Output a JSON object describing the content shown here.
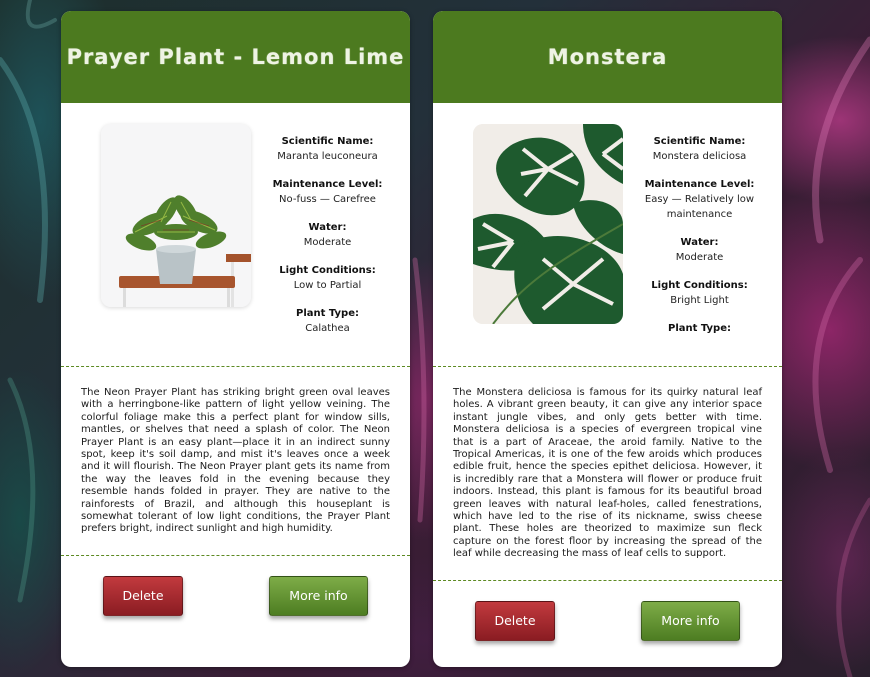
{
  "colors": {
    "header_green": "#4c7a1f",
    "delete_red": "#a82b30",
    "more_info_green": "#6a9a35",
    "divider_green": "#5c8a22"
  },
  "cards": [
    {
      "title": "Prayer Plant - Lemon Lime",
      "image_icon": "potted-prayer-plant-photo",
      "specs": [
        {
          "label": "Scientific Name:",
          "value": "Maranta leuconeura"
        },
        {
          "label": "Maintenance Level:",
          "value": "No-fuss — Carefree"
        },
        {
          "label": "Water:",
          "value": "Moderate"
        },
        {
          "label": "Light Conditions:",
          "value": "Low to Partial"
        },
        {
          "label": "Plant Type:",
          "value": "Calathea"
        }
      ],
      "description": "The Neon Prayer Plant has striking bright green oval leaves with a herringbone-like pattern of light yellow veining. The colorful foliage make this a perfect plant for window sills, mantles, or shelves that need a splash of color. The Neon Prayer Plant is an easy plant—place it in an indirect sunny spot, keep it's soil damp, and mist it's leaves once a week and it will flourish. The Neon Prayer plant gets its name from the way the leaves fold in the evening because they resemble hands folded in prayer. They are native to the rainforests of Brazil, and although this houseplant is somewhat tolerant of low light conditions, the Prayer Plant prefers bright, indirect sunlight and high humidity.",
      "delete_label": "Delete",
      "more_label": "More info"
    },
    {
      "title": "Monstera",
      "image_icon": "monstera-leaves-photo",
      "specs": [
        {
          "label": "Scientific Name:",
          "value": "Monstera deliciosa"
        },
        {
          "label": "Maintenance Level:",
          "value": "Easy — Relatively low maintenance"
        },
        {
          "label": "Water:",
          "value": "Moderate"
        },
        {
          "label": "Light Conditions:",
          "value": "Bright Light"
        },
        {
          "label": "Plant Type:",
          "value": ""
        }
      ],
      "description": "The Monstera deliciosa is famous for its quirky natural leaf holes. A vibrant green beauty, it can give any interior space instant jungle vibes, and only gets better with time. Monstera deliciosa is a species of evergreen tropical vine that is a part of Araceae, the aroid family. Native to the Tropical Americas, it is one of the few aroids which produces edible fruit, hence the species epithet deliciosa. However, it is incredibly rare that a Monstera will flower or produce fruit indoors. Instead, this plant is famous for its beautiful broad green leaves with natural leaf-holes, called fenestrations, which have led to the rise of its nickname, swiss cheese plant. These holes are theorized to maximize sun fleck capture on the forest floor by increasing the spread of the leaf while decreasing the mass of leaf cells to support.",
      "delete_label": "Delete",
      "more_label": "More info"
    }
  ]
}
